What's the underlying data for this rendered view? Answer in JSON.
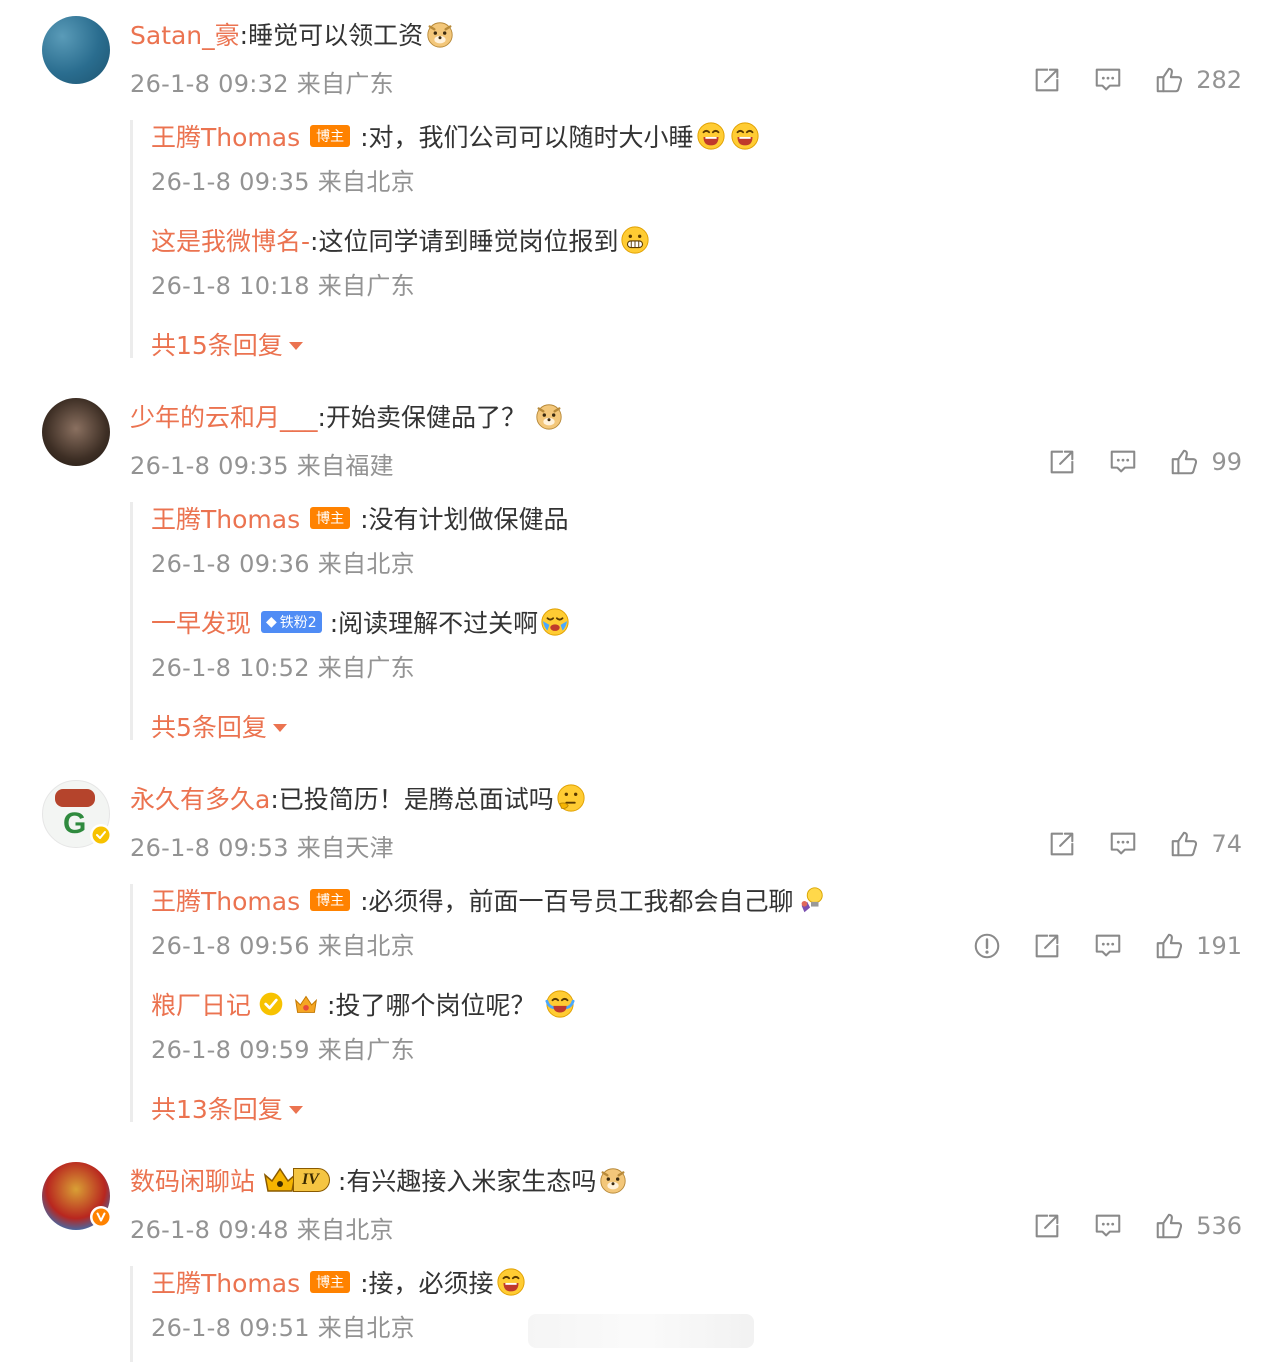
{
  "comments": [
    {
      "username": "Satan_豪",
      "text": ":睡觉可以领工资",
      "meta": "26-1-8 09:32 来自广东",
      "likes": "282",
      "replies": [
        {
          "username": "王腾Thomas",
          "tag": "博主",
          "text": ":对，我们公司可以随时大小睡",
          "meta": "26-1-8 09:35 来自北京"
        },
        {
          "username": "这是我微博名-",
          "text": ":这位同学请到睡觉岗位报到",
          "meta": "26-1-8 10:18 来自广东"
        }
      ],
      "more": "共15条回复"
    },
    {
      "username": "少年的云和月___",
      "text": ":开始卖保健品了？",
      "meta": "26-1-8 09:35 来自福建",
      "likes": "99",
      "replies": [
        {
          "username": "王腾Thomas",
          "tag": "博主",
          "text": ":没有计划做保健品",
          "meta": "26-1-8 09:36 来自北京"
        },
        {
          "username": "一早发现",
          "tag": "铁粉2",
          "text": ":阅读理解不过关啊",
          "meta": "26-1-8 10:52 来自广东"
        }
      ],
      "more": "共5条回复"
    },
    {
      "username": "永久有多久a",
      "text": ":已投简历！是腾总面试吗",
      "meta": "26-1-8 09:53 来自天津",
      "likes": "74",
      "replies": [
        {
          "username": "王腾Thomas",
          "tag": "博主",
          "text": ":必须得，前面一百号员工我都会自己聊",
          "meta": "26-1-8 09:56 来自北京",
          "likes": "191"
        },
        {
          "username": "粮厂日记",
          "text": ":投了哪个岗位呢？",
          "meta": "26-1-8 09:59 来自广东"
        }
      ],
      "more": "共13条回复"
    },
    {
      "username": "数码闲聊站",
      "badge": "IV",
      "text": ":有兴趣接入米家生态吗",
      "meta": "26-1-8 09:48 来自北京",
      "likes": "536",
      "replies": [
        {
          "username": "王腾Thomas",
          "tag": "博主",
          "text": ":接，必须接",
          "meta": "26-1-8 09:51 来自北京"
        }
      ]
    }
  ],
  "colors": {
    "username": "#eb7350",
    "text": "#333333",
    "meta": "#939393",
    "blogger_tag": "#ff8200",
    "fan_tag": "#4f8cf5"
  },
  "icons": [
    "share-icon",
    "comment-icon",
    "like-icon",
    "report-icon",
    "verified-icon",
    "caret-down-icon"
  ]
}
